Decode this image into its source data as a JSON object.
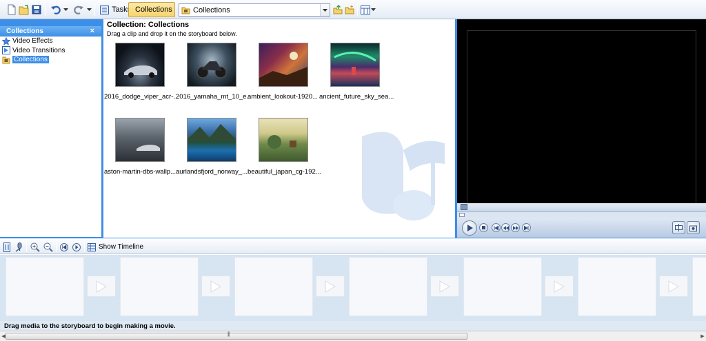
{
  "toolbar": {
    "tasks_label": "Tasks",
    "collections_label": "Collections",
    "collection_select_value": "Collections"
  },
  "left_pane": {
    "title": "Collections",
    "close": "×",
    "items": [
      {
        "label": "Video Effects",
        "icon": "star-icon"
      },
      {
        "label": "Video Transitions",
        "icon": "transition-icon"
      },
      {
        "label": "Collections",
        "icon": "collections-folder-icon",
        "selected": true
      }
    ]
  },
  "contents": {
    "title": "Collection: Collections",
    "subtitle": "Drag a clip and drop it on the storyboard below.",
    "clips": [
      {
        "name": "2016_dodge_viper_acr-..."
      },
      {
        "name": "2016_yamaha_mt_10_e..."
      },
      {
        "name": "ambient_lookout-1920..."
      },
      {
        "name": "ancient_future_sky_sea..."
      },
      {
        "name": "aston-martin-dbs-wallp..."
      },
      {
        "name": "aurlandsfjord_norway_..."
      },
      {
        "name": "beautiful_japan_cg-192..."
      }
    ]
  },
  "storyboard_toolbar": {
    "show_timeline_label": "Show Timeline"
  },
  "status": {
    "message": "Drag media to the storyboard to begin making a movie."
  },
  "colors": {
    "accent": "#3d8ee6",
    "preview_bg": "#000000",
    "storyboard_bg": "#d7e4f1"
  }
}
